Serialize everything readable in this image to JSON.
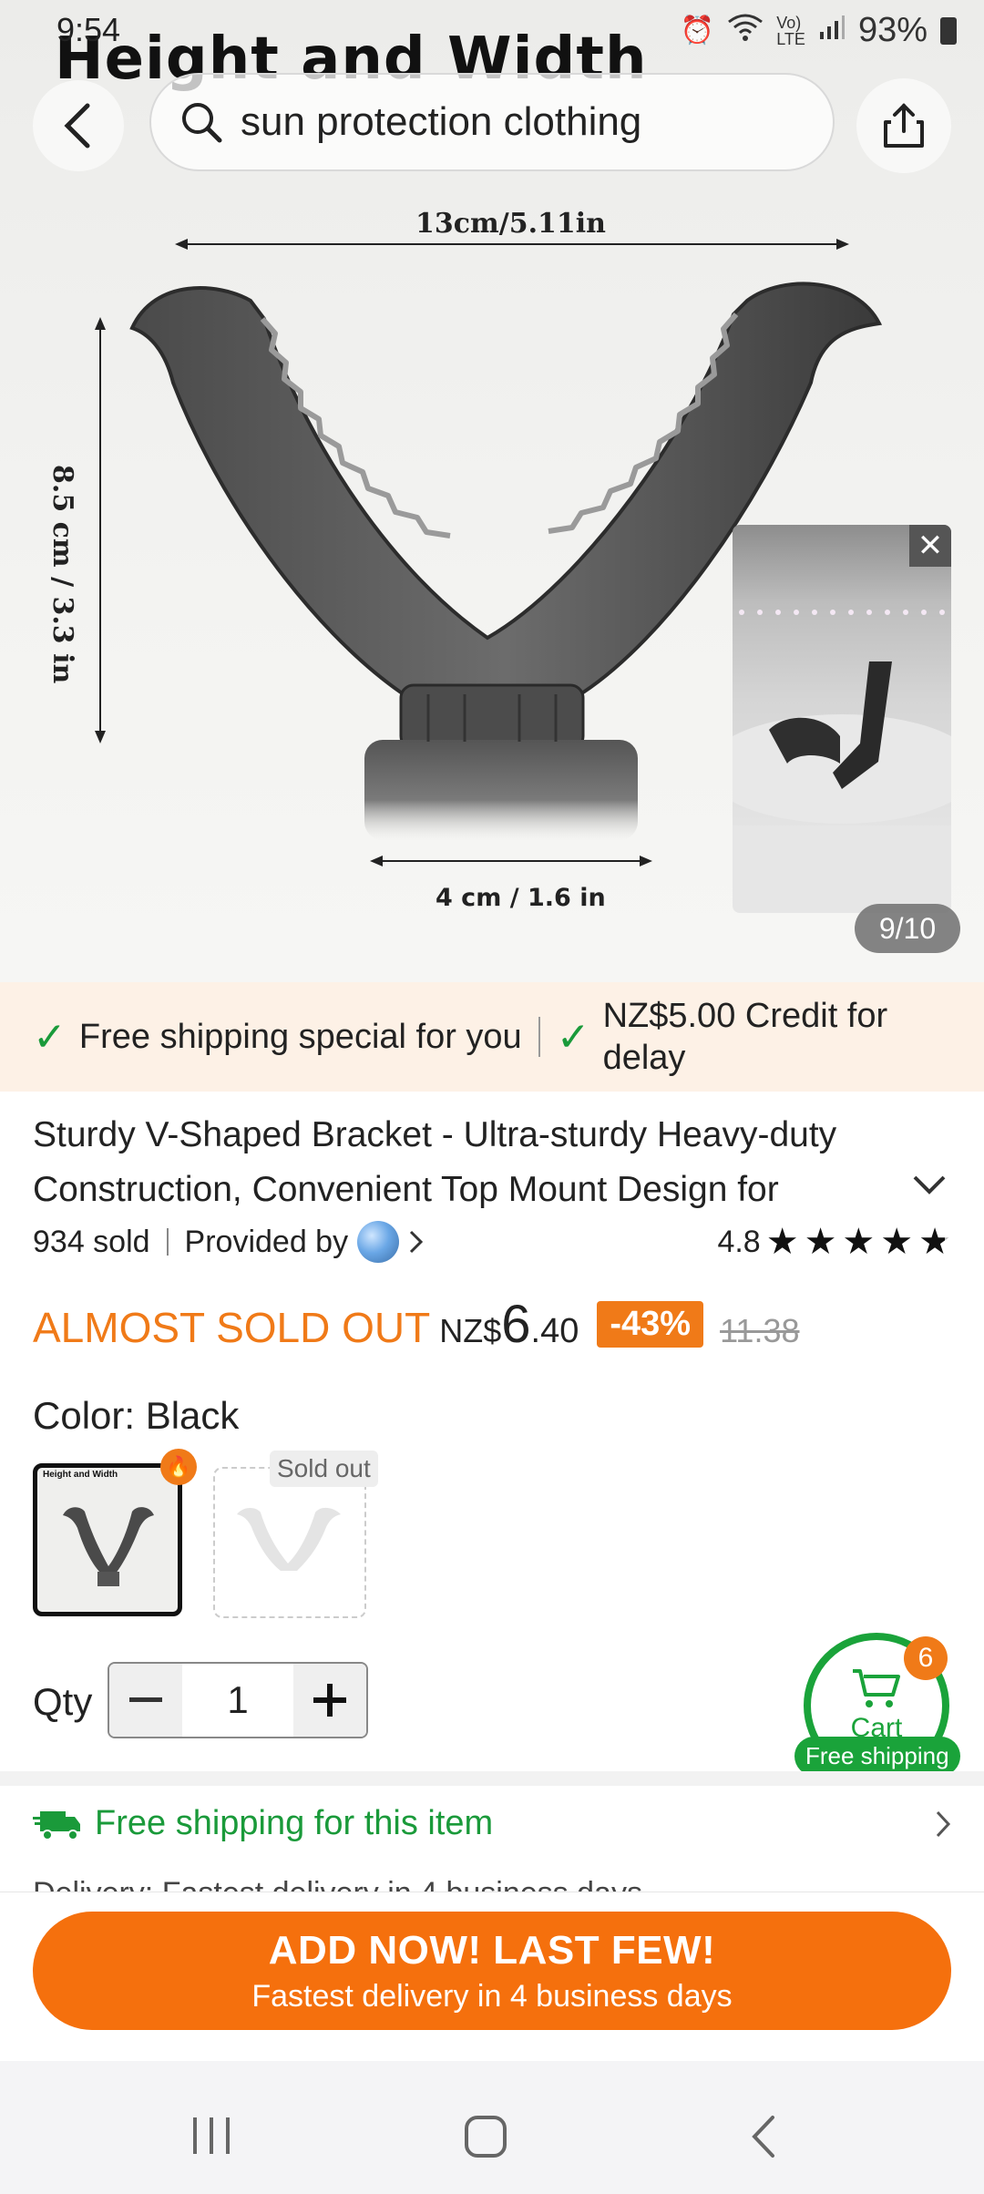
{
  "status_bar": {
    "time": "9:54",
    "battery": "93%"
  },
  "hero": {
    "overlay_title": "Height and Width",
    "search_text": "sun protection clothing",
    "dim_top": "13cm/5.11in",
    "dim_left": "8.5 cm / 3.3 in",
    "dim_bottom": "4 cm / 1.6 in",
    "page_counter": "9/10"
  },
  "banner": {
    "free_shipping": "Free shipping special for you",
    "credit_line1": "NZ$5.00 Credit for",
    "credit_line2": "delay"
  },
  "product": {
    "title": "Sturdy V-Shaped Bracket - Ultra-sturdy Heavy-duty Construction, Convenient Top Mount Design for",
    "sold": "934 sold",
    "provided_by": "Provided by",
    "rating": "4.8",
    "stars": 5
  },
  "price": {
    "urgency": "ALMOST SOLD OUT",
    "currency": "NZ$",
    "main": "6",
    "decimal": ".40",
    "discount": "-43%",
    "original": "11.38"
  },
  "variants": {
    "color_label": "Color: Black",
    "swatch1_caption": "Height and Width",
    "sold_out": "Sold out"
  },
  "quantity": {
    "label": "Qty",
    "value": "1"
  },
  "cart": {
    "label": "Cart",
    "count": "6",
    "free_shipping": "Free shipping"
  },
  "shipping_row": {
    "text": "Free shipping for this item",
    "delivery_peek": "Delivery: Fastest delivery in 4 business days"
  },
  "cta": {
    "main": "ADD NOW! LAST FEW!",
    "sub": "Fastest delivery in 4 business days"
  },
  "colors": {
    "accent": "#f5700d",
    "green": "#1a9a3a",
    "banner_bg": "#fdf1e6"
  }
}
